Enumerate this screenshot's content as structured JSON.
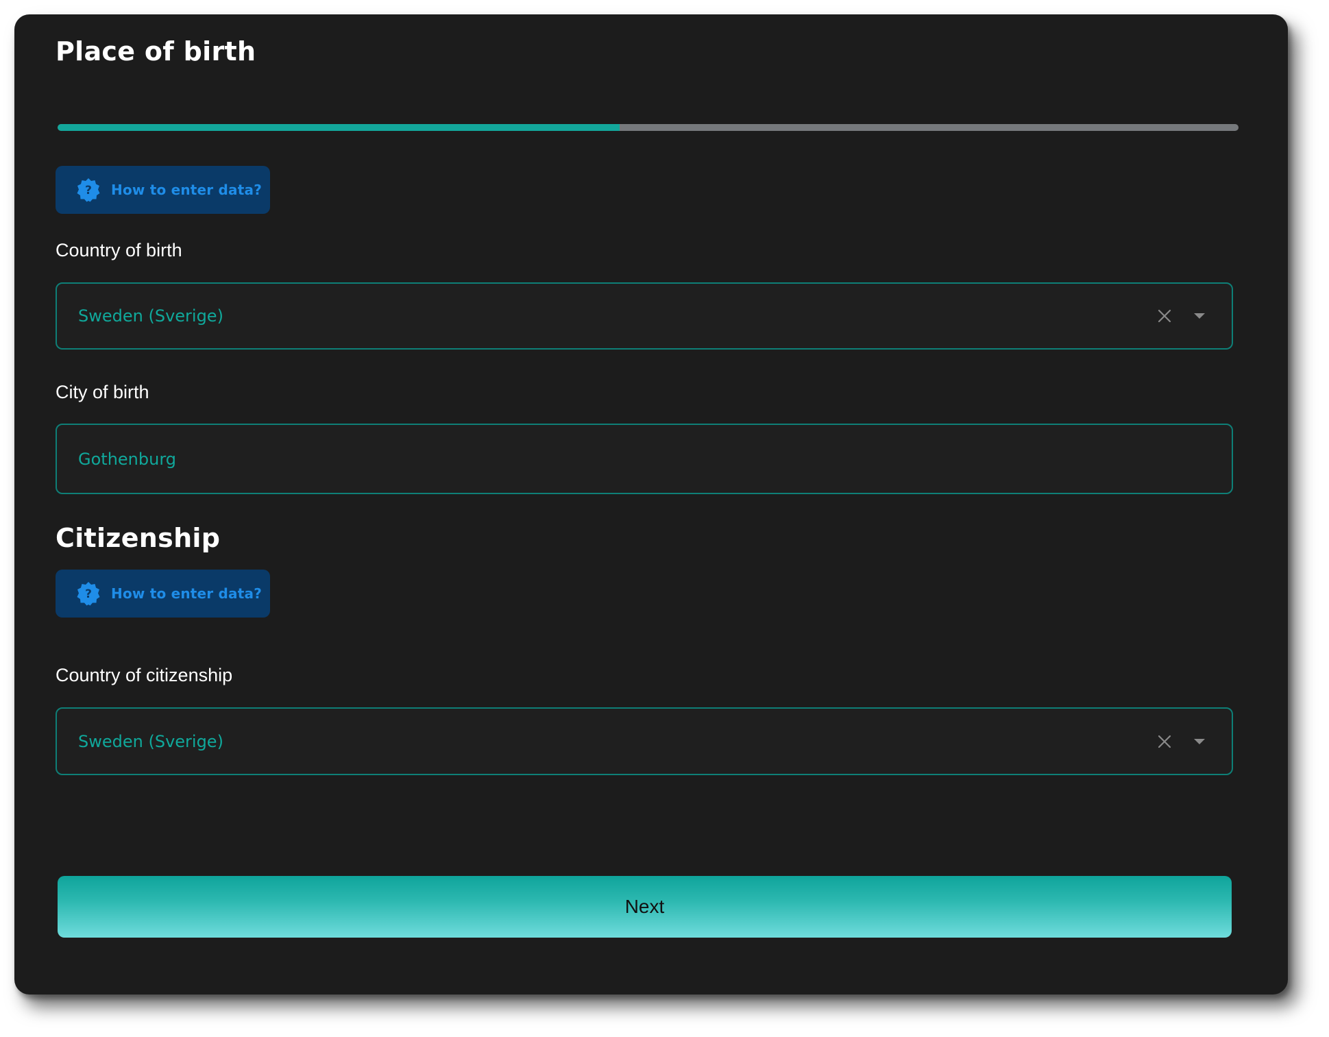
{
  "header": {
    "title": "Place of birth"
  },
  "progress": {
    "fraction": 0.476,
    "fill_color": "#13a79b",
    "track_color": "#76797c"
  },
  "help": {
    "icon": "question-badge-icon",
    "label": "How to enter data?"
  },
  "birth": {
    "country_label": "Country of birth",
    "country_value": "Sweden (Sverige)",
    "city_label": "City of birth",
    "city_value": "Gothenburg"
  },
  "citizenship": {
    "section_title": "Citizenship",
    "help_label": "How to enter data?",
    "country_label": "Country of citizenship",
    "country_value": "Sweden (Sverige)"
  },
  "actions": {
    "next_label": "Next"
  },
  "colors": {
    "accent": "#10a89b",
    "card_background": "#1c1c1c",
    "help_background": "#0a3a68",
    "help_text": "#1f8de8"
  }
}
